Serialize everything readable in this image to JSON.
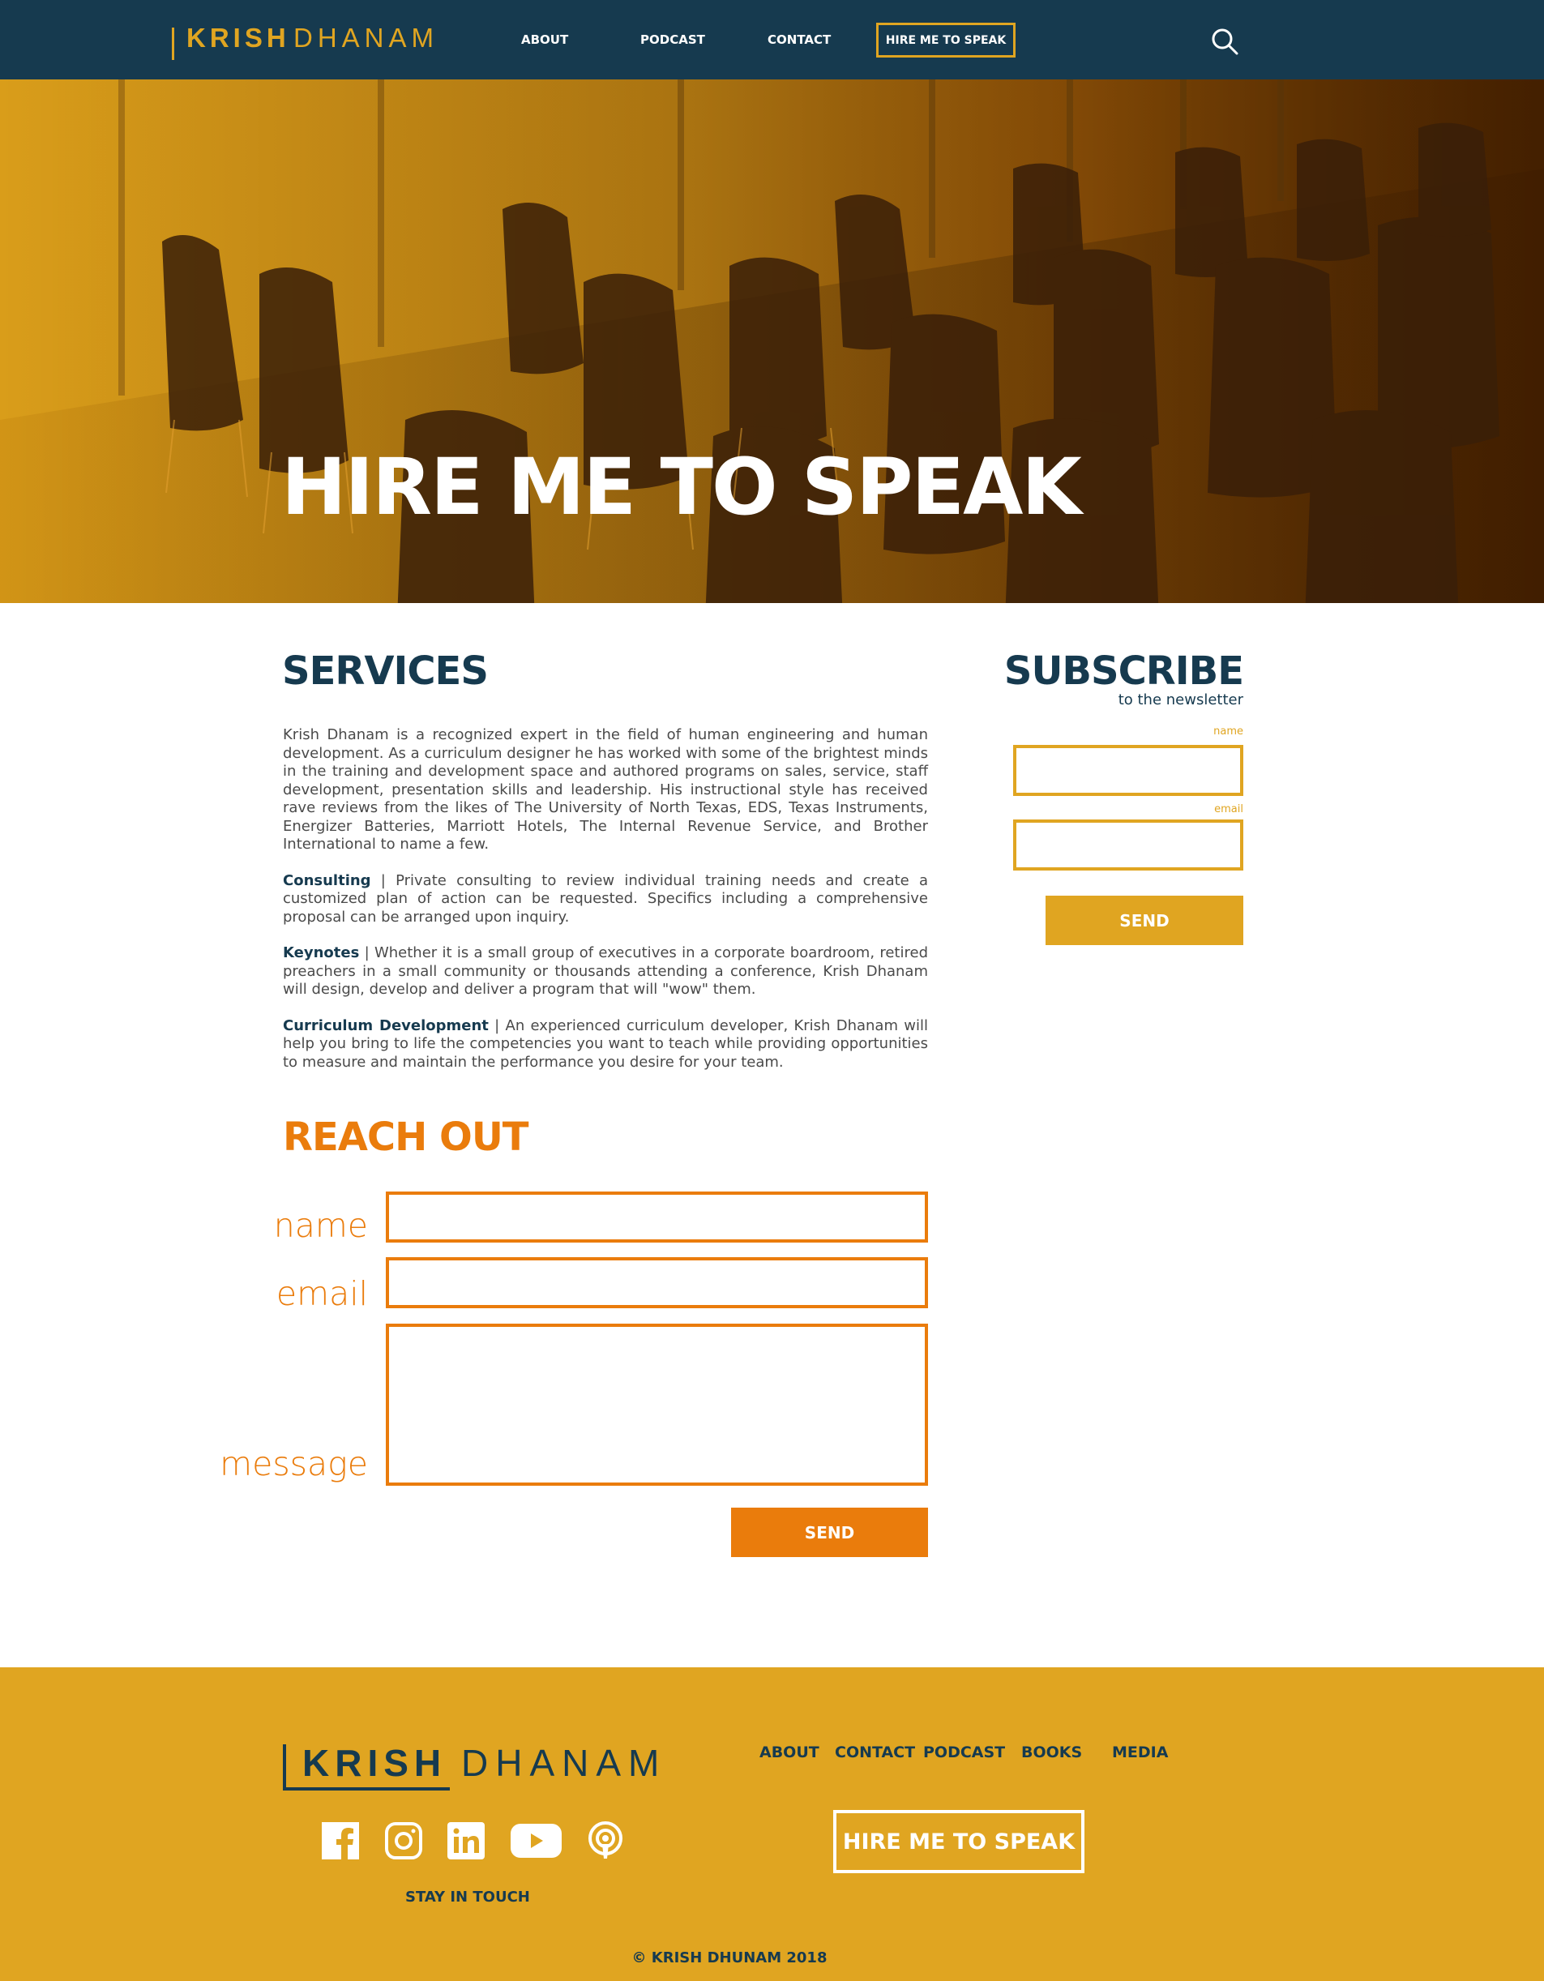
{
  "header": {
    "logo_first": "KRISH",
    "logo_last": "DHANAM",
    "nav": {
      "about": "ABOUT",
      "podcast": "PODCAST",
      "contact": "CONTACT"
    },
    "hire_button": "HIRE ME TO SPEAK",
    "search_icon": "search-icon"
  },
  "hero": {
    "title": "HIRE ME TO SPEAK"
  },
  "services": {
    "title": "SERVICES",
    "intro": "Krish Dhanam is a recognized expert in the field of human engineering and human development. As a curriculum designer he has worked with some of the brightest minds in the training and development space and authored programs on sales, service, staff development, presentation skills and leadership. His instructional style has received rave reviews from the likes of The University of North Texas, EDS, Texas Instruments, Energizer Batteries, Marriott Hotels, The Internal Revenue Service, and Brother International to name a few.",
    "items": [
      {
        "name": "Consulting",
        "text": " | Private consulting to review individual training needs and create a customized plan of action can be requested. Specifics including a comprehensive proposal can be arranged upon inquiry."
      },
      {
        "name": "Keynotes",
        "text": " | Whether it is a small group of executives in a corporate boardroom, retired preachers in a small community or thousands attending a conference, Krish Dhanam will design, develop and deliver a program that will \"wow\" them."
      },
      {
        "name": "Curriculum Development",
        "text": " | An experienced curriculum developer, Krish Dhanam will help you bring to life the competencies you want to teach while providing opportunities to measure and maintain the performance you desire for your team."
      }
    ]
  },
  "subscribe": {
    "title": "SUBSCRIBE",
    "subtitle": "to the newsletter",
    "name_label": "name",
    "email_label": "email",
    "send": "SEND"
  },
  "reach_out": {
    "title": "REACH OUT",
    "name_label": "name",
    "email_label": "email",
    "message_label": "message",
    "send": "SEND"
  },
  "footer": {
    "logo_first": "KRISH",
    "logo_last": "DHANAM",
    "nav": [
      "ABOUT",
      "CONTACT",
      "PODCAST",
      "BOOKS",
      "MEDIA"
    ],
    "social_icons": [
      "facebook-icon",
      "instagram-icon",
      "linkedin-icon",
      "youtube-icon",
      "podcast-icon"
    ],
    "stay_in_touch": "STAY IN TOUCH",
    "hire_button": "HIRE ME TO SPEAK",
    "copyright": "© KRISH DHUNAM 2018"
  },
  "colors": {
    "navy": "#163a4f",
    "gold": "#e0a521",
    "orange": "#ea7c0c"
  }
}
